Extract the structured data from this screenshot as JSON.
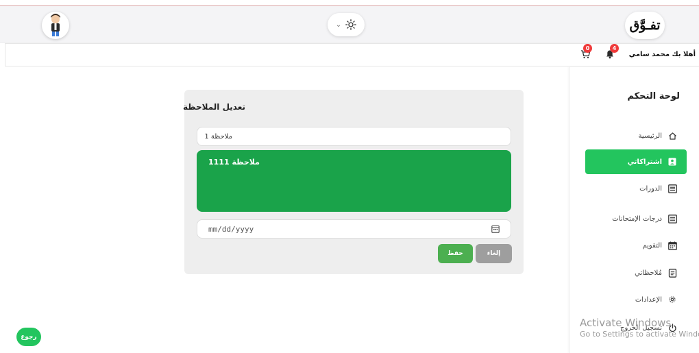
{
  "header": {
    "logo": "تفـوَّق",
    "theme_icon": "sun-icon",
    "avatar_icon": "user-avatar"
  },
  "subheader": {
    "greeting": "أهلا بك محمد سامي",
    "notifications_count": "4",
    "cart_count": "0"
  },
  "sidebar": {
    "title": "لوحة التحكم",
    "items": [
      {
        "label": "الرئيسية",
        "icon": "home-icon"
      },
      {
        "label": "اشتراكاتي",
        "icon": "id-card-icon"
      },
      {
        "label": "الدورات",
        "icon": "list-icon"
      },
      {
        "label": "درجات الإمتحانات",
        "icon": "list-icon"
      },
      {
        "label": "التقويم",
        "icon": "calendar-icon"
      },
      {
        "label": "مُلاحظاتي",
        "icon": "notes-icon"
      },
      {
        "label": "الإعدادات",
        "icon": "gear-icon"
      },
      {
        "label": "تسجيل الخروج",
        "icon": "power-icon"
      }
    ]
  },
  "form": {
    "heading": "تعديل الملاحظة",
    "title_value": "ملاحظة 1",
    "content_value": "ملاحظة 1111",
    "date_placeholder": "mm/dd/yyyy",
    "cancel_label": "إلغاء",
    "save_label": "حفظ"
  },
  "back_label": "رجوع",
  "watermark": {
    "title": "Activate Windows",
    "subtitle": "Go to Settings to activate Windows."
  },
  "colors": {
    "accent": "#23c55e",
    "editor": "#1aa34a",
    "badge": "#ef3a3a",
    "save": "#4caf50",
    "cancel": "#9e9e9e"
  }
}
